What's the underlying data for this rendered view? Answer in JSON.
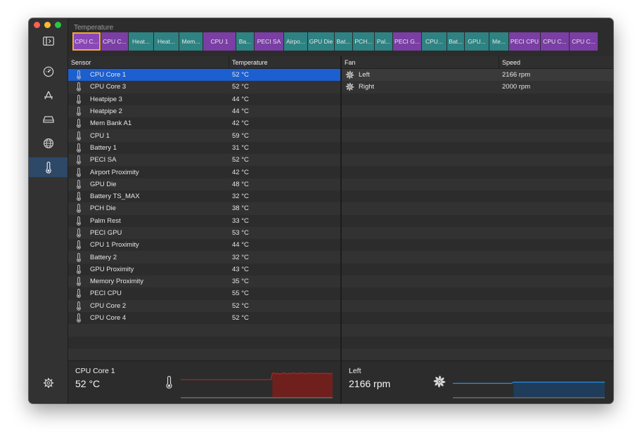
{
  "window": {
    "title": "Temperature",
    "traffic_colors": [
      "#fe5f57",
      "#febc2e",
      "#28c840"
    ]
  },
  "sidebar": {
    "items": [
      {
        "name": "sidebar-toggle",
        "icon": "sidebar-toggle-icon",
        "active": false
      },
      {
        "name": "gauge",
        "icon": "gauge-icon",
        "active": false
      },
      {
        "name": "processes",
        "icon": "app-store-icon",
        "active": false
      },
      {
        "name": "disk",
        "icon": "drive-icon",
        "active": false
      },
      {
        "name": "network",
        "icon": "globe-icon",
        "active": false
      },
      {
        "name": "temperature",
        "icon": "thermometer-icon",
        "active": true
      },
      {
        "name": "settings",
        "icon": "gear-icon",
        "active": false
      }
    ]
  },
  "tabs": [
    {
      "label": "CPU C...",
      "color": "purple",
      "selected": true,
      "width": 40
    },
    {
      "label": "CPU C...",
      "color": "purple",
      "width": 38
    },
    {
      "label": "Heat...",
      "color": "teal",
      "width": 35
    },
    {
      "label": "Heat...",
      "color": "teal",
      "width": 35
    },
    {
      "label": "Mem...",
      "color": "teal",
      "width": 33
    },
    {
      "label": "CPU 1",
      "color": "purple",
      "width": 46
    },
    {
      "label": "Ba...",
      "color": "teal",
      "width": 25
    },
    {
      "label": "PECI SA",
      "color": "purple",
      "width": 41
    },
    {
      "label": "Airpo...",
      "color": "teal",
      "width": 33
    },
    {
      "label": "GPU Die",
      "color": "teal",
      "width": 37
    },
    {
      "label": "Bat...",
      "color": "teal",
      "width": 25
    },
    {
      "label": "PCH...",
      "color": "teal",
      "width": 30
    },
    {
      "label": "Pal...",
      "color": "teal",
      "width": 25
    },
    {
      "label": "PECI G...",
      "color": "purple",
      "width": 40
    },
    {
      "label": "CPU...",
      "color": "teal",
      "width": 35
    },
    {
      "label": "Bat...",
      "color": "teal",
      "width": 24
    },
    {
      "label": "GPU...",
      "color": "teal",
      "width": 34
    },
    {
      "label": "Me...",
      "color": "teal",
      "width": 27
    },
    {
      "label": "PECI CPU",
      "color": "purple",
      "width": 44
    },
    {
      "label": "CPU C...",
      "color": "purple",
      "width": 40
    },
    {
      "label": "CPU C...",
      "color": "purple",
      "width": 40
    }
  ],
  "sensor_table": {
    "columns": [
      "Sensor",
      "Temperature"
    ],
    "rows": [
      {
        "sensor": "CPU Core 1",
        "temp": "52 °C",
        "selected": true
      },
      {
        "sensor": "CPU Core 3",
        "temp": "52 °C"
      },
      {
        "sensor": "Heatpipe 3",
        "temp": "44 °C"
      },
      {
        "sensor": "Heatpipe 2",
        "temp": "44 °C"
      },
      {
        "sensor": "Mem Bank A1",
        "temp": "42 °C"
      },
      {
        "sensor": "CPU 1",
        "temp": "59 °C"
      },
      {
        "sensor": "Battery 1",
        "temp": "31 °C"
      },
      {
        "sensor": "PECI SA",
        "temp": "52 °C"
      },
      {
        "sensor": "Airport Proximity",
        "temp": "42 °C"
      },
      {
        "sensor": "GPU Die",
        "temp": "48 °C"
      },
      {
        "sensor": "Battery TS_MAX",
        "temp": "32 °C"
      },
      {
        "sensor": "PCH Die",
        "temp": "38 °C"
      },
      {
        "sensor": "Palm Rest",
        "temp": "33 °C"
      },
      {
        "sensor": "PECI GPU",
        "temp": "53 °C"
      },
      {
        "sensor": "CPU 1 Proximity",
        "temp": "44 °C"
      },
      {
        "sensor": "Battery 2",
        "temp": "32 °C"
      },
      {
        "sensor": "GPU Proximity",
        "temp": "43 °C"
      },
      {
        "sensor": "Memory Proximity",
        "temp": "35 °C"
      },
      {
        "sensor": "PECI CPU",
        "temp": "55 °C"
      },
      {
        "sensor": "CPU Core 2",
        "temp": "52 °C"
      },
      {
        "sensor": "CPU Core 4",
        "temp": "52 °C"
      }
    ]
  },
  "fan_table": {
    "columns": [
      "Fan",
      "Speed"
    ],
    "rows": [
      {
        "fan": "Left",
        "speed": "2166 rpm"
      },
      {
        "fan": "Right",
        "speed": "2000 rpm"
      }
    ]
  },
  "detail_sensor": {
    "name": "CPU Core 1",
    "value": "52 °C",
    "history": [
      38,
      38,
      38,
      38,
      38,
      38,
      38,
      38,
      38,
      38,
      38,
      38,
      38,
      38,
      38,
      38,
      38,
      38,
      38,
      38,
      38,
      38,
      38,
      38,
      38,
      38,
      38,
      38,
      38,
      38,
      38,
      38,
      38,
      38,
      38,
      38,
      38,
      38,
      38,
      38,
      38,
      38,
      38,
      38,
      38,
      38,
      38,
      38,
      38,
      38,
      38,
      38,
      38,
      38,
      38,
      38,
      38,
      38,
      38,
      38,
      38,
      38,
      38,
      38,
      52,
      53,
      51,
      52,
      52,
      50,
      51,
      52,
      53,
      52,
      51,
      52,
      52,
      51,
      52,
      53,
      52,
      51,
      52,
      52,
      53,
      52,
      52,
      51,
      52,
      52,
      53,
      52,
      51,
      52,
      52,
      52,
      52,
      51,
      52,
      52,
      52,
      51,
      52,
      52,
      51,
      52,
      52
    ],
    "range": [
      0,
      60
    ],
    "line_color": "#b3271f",
    "fill_color": "#7c1e1a"
  },
  "detail_fan": {
    "name": "Left",
    "value": "2166 rpm",
    "history": [
      2000,
      2000,
      2000,
      2000,
      2000,
      2000,
      2000,
      2000,
      2000,
      2000,
      2000,
      2000,
      2000,
      2000,
      2000,
      2000,
      2000,
      2000,
      2000,
      2000,
      2000,
      2000,
      2000,
      2000,
      2000,
      2000,
      2000,
      2000,
      2000,
      2000,
      2166,
      2166,
      2166,
      2166,
      2166,
      2166,
      2166,
      2166,
      2166,
      2166,
      2166,
      2166,
      2166,
      2166,
      2166,
      2166,
      2166,
      2166,
      2166,
      2166,
      2166,
      2166,
      2166,
      2166,
      2166,
      2166,
      2166,
      2166,
      2166,
      2166,
      2166,
      2166,
      2166,
      2166,
      2166,
      2166,
      2166,
      2166,
      2166,
      2166,
      2166,
      2166,
      2166,
      2166,
      2166,
      2166
    ],
    "range": [
      0,
      4000
    ],
    "line_color": "#2a8ff0",
    "fill_color": "#1d3f63"
  }
}
